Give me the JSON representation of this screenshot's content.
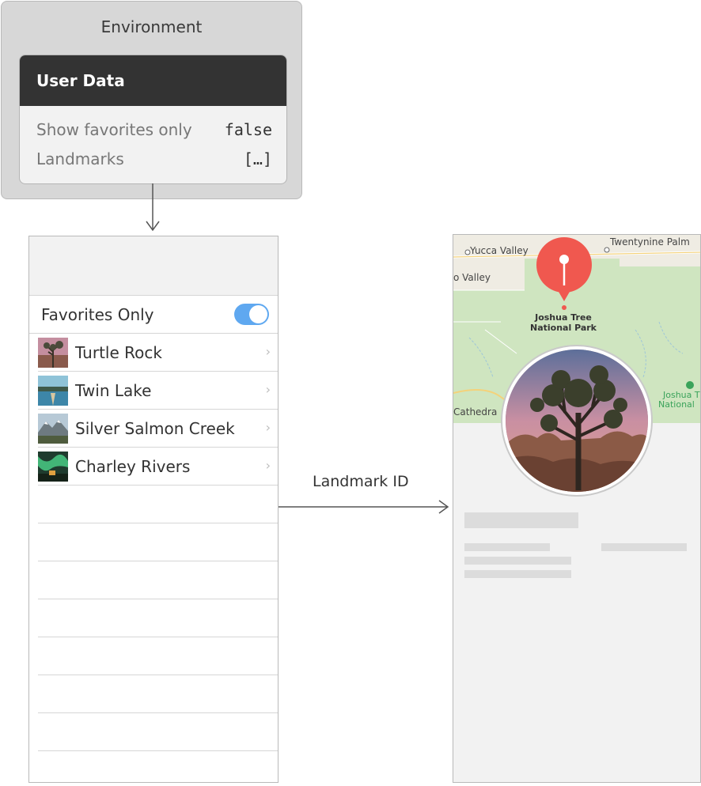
{
  "environment": {
    "title": "Environment",
    "user_data": {
      "title": "User Data",
      "rows": [
        {
          "label": "Show favorites only",
          "value": "false"
        },
        {
          "label": "Landmarks",
          "value": "[…]"
        }
      ]
    }
  },
  "list_view": {
    "toggle_label": "Favorites Only",
    "toggle_on": true,
    "items": [
      {
        "name": "Turtle Rock"
      },
      {
        "name": "Twin Lake"
      },
      {
        "name": "Silver Salmon Creek"
      },
      {
        "name": "Charley Rivers"
      }
    ],
    "chevron": "›"
  },
  "arrow_label": "Landmark ID",
  "detail_view": {
    "map_labels": {
      "yucca_valley": "Yucca Valley",
      "twentynine_palms": "Twentynine Palm",
      "valley": "o Valley",
      "cathedral": "Cathedra",
      "joshua_tree": "Joshua Tree",
      "national_park": "National Park",
      "joshua_right_1": "Joshua T",
      "joshua_right_2": "National"
    }
  },
  "colors": {
    "accent_toggle": "#5fa8f0",
    "header_dark": "#333333",
    "pin_red": "#f0584f"
  }
}
